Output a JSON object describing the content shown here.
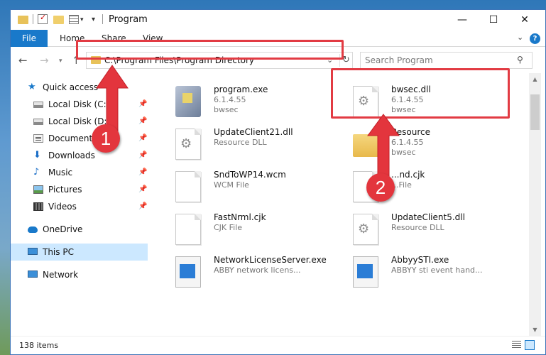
{
  "window": {
    "title": "Program"
  },
  "ribbon": {
    "tabs": [
      "File",
      "Home",
      "Share",
      "View"
    ]
  },
  "nav": {
    "address": "C:\\Program Files\\Program Directory",
    "search_placeholder": "Search Program"
  },
  "sidebar": {
    "items": [
      {
        "label": "Quick access"
      },
      {
        "label": "Local Disk (C:)"
      },
      {
        "label": "Local Disk (D:)"
      },
      {
        "label": "Documents"
      },
      {
        "label": "Downloads"
      },
      {
        "label": "Music"
      },
      {
        "label": "Pictures"
      },
      {
        "label": "Videos"
      },
      {
        "label": "OneDrive"
      },
      {
        "label": "This PC"
      },
      {
        "label": "Network"
      }
    ]
  },
  "files": [
    {
      "name": "program.exe",
      "line2": "6.1.4.55",
      "line3": "bwsec"
    },
    {
      "name": "bwsec.dll",
      "line2": "6.1.4.55",
      "line3": "bwsec"
    },
    {
      "name": "UpdateClient21.dll",
      "line2": "Resource DLL",
      "line3": ""
    },
    {
      "name": "Resource",
      "line2": "6.1.4.55",
      "line3": "bwsec"
    },
    {
      "name": "SndToWP14.wcm",
      "line2": "WCM File",
      "line3": ""
    },
    {
      "name": "...nd.cjk",
      "line2": "...File",
      "line3": ""
    },
    {
      "name": "FastNrml.cjk",
      "line2": "CJK File",
      "line3": ""
    },
    {
      "name": "UpdateClient5.dll",
      "line2": "Resource DLL",
      "line3": ""
    },
    {
      "name": "NetworkLicenseServer.exe",
      "line2": "ABBY network licens...",
      "line3": ""
    },
    {
      "name": "AbbyySTI.exe",
      "line2": "ABBYY sti event hand...",
      "line3": ""
    }
  ],
  "status": {
    "count": "138 items"
  },
  "annotations": {
    "badge1": "1",
    "badge2": "2",
    "color": "#e3353d"
  }
}
